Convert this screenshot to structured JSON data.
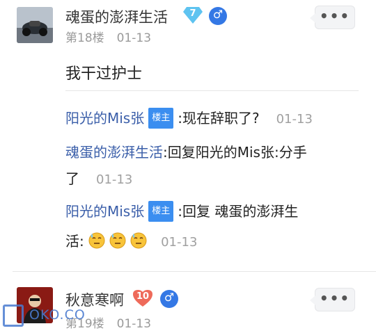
{
  "post1": {
    "username": "魂蛋的澎湃生活",
    "level": "7",
    "floor": "第18楼",
    "date": "01-13",
    "content": "我干过护士",
    "more_label": "•••"
  },
  "replies": [
    {
      "user": "阳光的Mis张",
      "tag": "楼主",
      "text": ":现在辞职了?",
      "date": "01-13"
    },
    {
      "user": "魂蛋的澎湃生活",
      "text": ":回复阳光的Mis张:分手",
      "text2": "了",
      "date": "01-13"
    },
    {
      "user": "阳光的Mis张",
      "tag": "楼主",
      "text": ":回复 魂蛋的澎湃生",
      "text2": "活:",
      "date": "01-13"
    }
  ],
  "post2": {
    "username": "秋意寒啊",
    "level": "10",
    "floor": "第19楼",
    "date": "01-13",
    "more_label": "•••"
  },
  "gender_symbol": "♂",
  "watermark": "OKO.CO",
  "colors": {
    "link": "#3a5ea9",
    "host_tag": "#3b8ef0",
    "gender": "#3478e5",
    "level_blue": "#5ec3f0",
    "level_red": "#ee6a5a"
  }
}
